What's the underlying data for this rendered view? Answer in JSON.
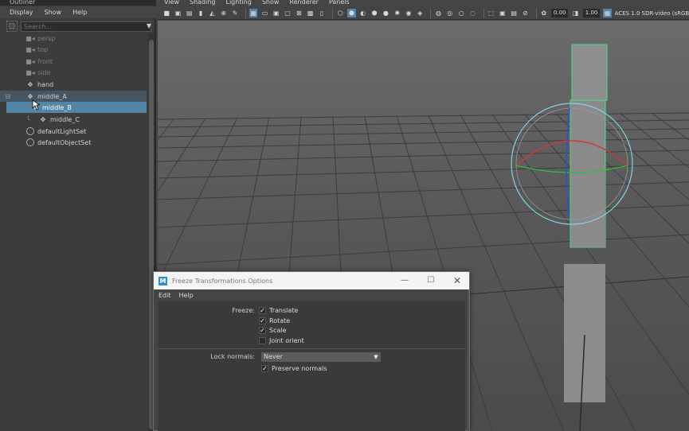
{
  "outliner": {
    "title": "Outliner",
    "menu": [
      "Display",
      "Show",
      "Help"
    ],
    "search_placeholder": "Search...",
    "items": [
      {
        "label": "persp",
        "icon": "camera-icon",
        "dim": true
      },
      {
        "label": "top",
        "icon": "camera-icon",
        "dim": true
      },
      {
        "label": "front",
        "icon": "camera-icon",
        "dim": true
      },
      {
        "label": "side",
        "icon": "camera-icon",
        "dim": true
      },
      {
        "label": "hand",
        "icon": "joint-icon",
        "dim": false
      },
      {
        "label": "middle_A",
        "icon": "joint-icon",
        "dim": false,
        "expanded": true
      },
      {
        "label": "middle_B",
        "icon": "joint-icon",
        "dim": false,
        "selected": true
      },
      {
        "label": "middle_C",
        "icon": "joint-icon",
        "dim": false
      },
      {
        "label": "defaultLightSet",
        "icon": "set-icon",
        "dim": false
      },
      {
        "label": "defaultObjectSet",
        "icon": "set-icon",
        "dim": false
      }
    ]
  },
  "viewport": {
    "menu": [
      "View",
      "Shading",
      "Lighting",
      "Show",
      "Renderer",
      "Panels"
    ],
    "toolbar": {
      "exposure": "0.00",
      "gamma": "1.00",
      "color_space": "ACES 1.0 SDR-video (sRGB"
    }
  },
  "dialog": {
    "title": "Freeze Transformations Options",
    "menu": [
      "Edit",
      "Help"
    ],
    "freeze_label": "Freeze:",
    "options": [
      {
        "label": "Translate",
        "checked": true
      },
      {
        "label": "Rotate",
        "checked": true
      },
      {
        "label": "Scale",
        "checked": true
      },
      {
        "label": "Joint orient",
        "checked": false
      }
    ],
    "lock_normals_label": "Lock normals:",
    "lock_normals_value": "Never",
    "preserve_normals_label": "Preserve normals",
    "preserve_normals_checked": true,
    "logo_letter": "M"
  },
  "colors": {
    "selection": "#5285a6",
    "manip_x": "#d23a3a",
    "manip_y": "#2fbf3a",
    "manip_z": "#2f4fd2",
    "manip_ring": "#7fd3e8"
  }
}
